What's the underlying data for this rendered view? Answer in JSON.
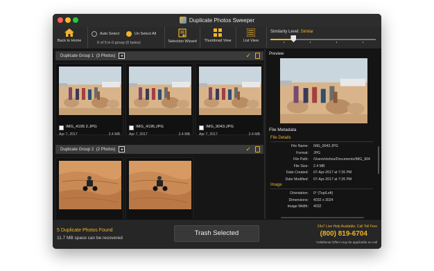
{
  "window": {
    "title": "Duplicate Photos Sweeper"
  },
  "toolbar": {
    "back_label": "Back to Home",
    "auto_select_label": "Auto Select",
    "unselect_all_label": "Un Select All",
    "counter": "0 of 5 in 0 group (0 bytes)",
    "selection_wizard_label": "Selection Wizard",
    "thumbnail_view_label": "Thumbnail View",
    "list_view_label": "List View",
    "similarity_label": "Similarity Level:",
    "similarity_value": "Similar",
    "similarity_level": 0.22
  },
  "groups": [
    {
      "title": "Duplicate Group 1",
      "count": "(3 Photos)",
      "photos": [
        {
          "name": "IMG_4195 2.JPG",
          "date": "Apr 7, 2017",
          "size": "2.4 MB"
        },
        {
          "name": "IMG_4195.JPG",
          "date": "Apr 7, 2017",
          "size": "2.4 MB"
        },
        {
          "name": "IMG_9043.JPG",
          "date": "Apr 7, 2017",
          "size": "2.4 MB"
        }
      ]
    },
    {
      "title": "Duplicate Group 2",
      "count": "(2 Photos)",
      "photos": [
        {
          "name": "",
          "date": "",
          "size": ""
        },
        {
          "name": "",
          "date": "",
          "size": ""
        }
      ]
    }
  ],
  "preview": {
    "label": "Preview",
    "metadata_title": "File Metadata",
    "file_details_label": "File Details",
    "file_details": [
      {
        "key": "File Name:",
        "value": "IMG_9043.JPG"
      },
      {
        "key": "Format:",
        "value": "JPG"
      },
      {
        "key": "File Path:",
        "value": "/Users/vishnu/Documents/IMG_904"
      },
      {
        "key": "File Size:",
        "value": "2.4 MB"
      },
      {
        "key": "Date Created:",
        "value": "07-Apr-2017 at 7:26 PM"
      },
      {
        "key": "Date Modified:",
        "value": "07-Apr-2017 at 7:26 PM"
      }
    ],
    "image_label": "Image",
    "image_details": [
      {
        "key": "Orientation:",
        "value": "0° (Top/Left)"
      },
      {
        "key": "Dimensions:",
        "value": "4032 x 3024"
      },
      {
        "key": "Image Width:",
        "value": "4032"
      }
    ]
  },
  "footer": {
    "found": "5 Duplicate Photos Found",
    "recover": "11.7 MB space can be recovered",
    "trash_label": "Trash Selected",
    "help": "24x7 Live Help Available, Call Toll Free",
    "phone": "(800) 819-6704",
    "disclaimer": "*Additional Offers may be applicable on call"
  },
  "colors": {
    "accent": "#f0b429",
    "background": "#1b1b1b"
  }
}
